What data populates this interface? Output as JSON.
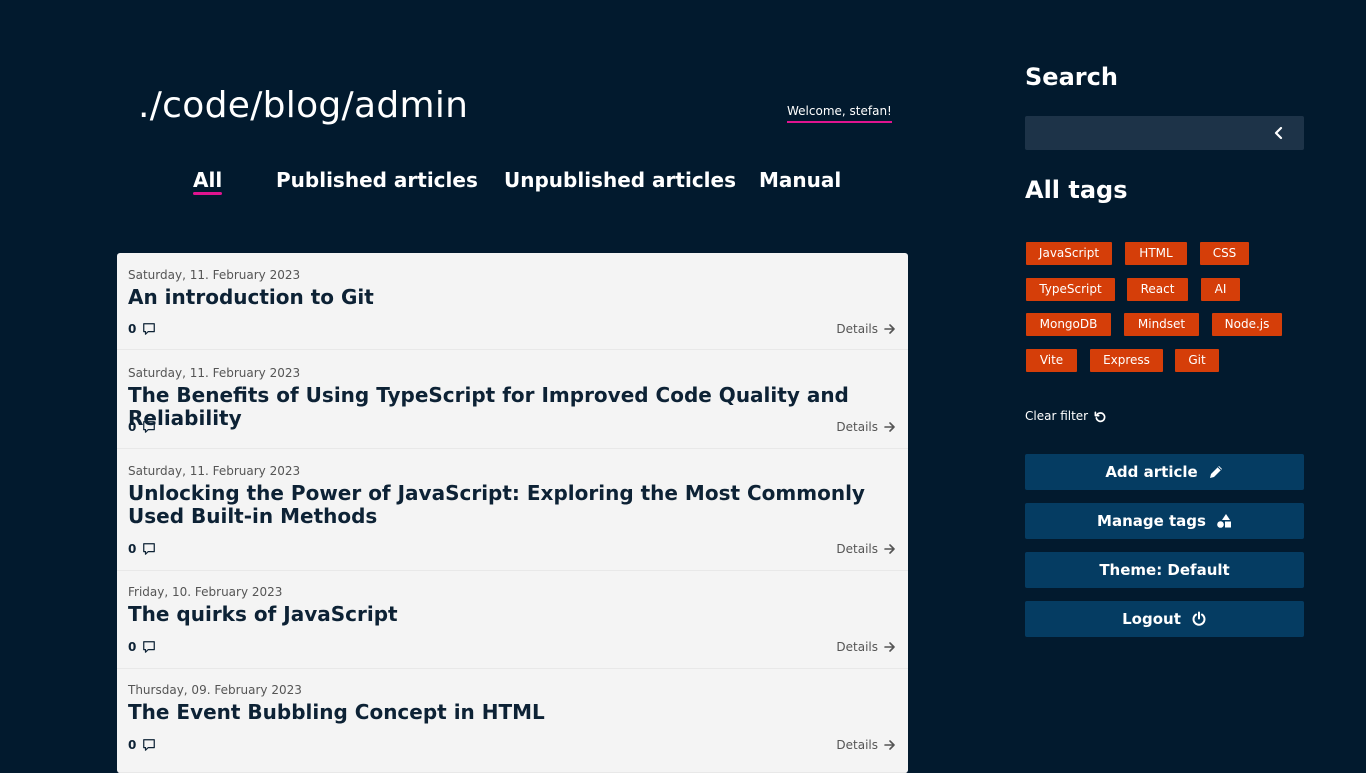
{
  "header": {
    "site_title": "./code/blog/admin",
    "welcome": "Welcome, stefan!"
  },
  "nav": {
    "tabs": [
      {
        "label": "All",
        "active": true
      },
      {
        "label": "Published articles"
      },
      {
        "label": "Unpublished articles"
      },
      {
        "label": "Manual"
      }
    ]
  },
  "articles": [
    {
      "date": "Saturday, 11. February 2023",
      "title": "An introduction to Git",
      "comments": "0",
      "details_label": "Details"
    },
    {
      "date": "Saturday, 11. February 2023",
      "title": "The Benefits of Using TypeScript for Improved Code Quality and Reliability",
      "comments": "0",
      "details_label": "Details"
    },
    {
      "date": "Saturday, 11. February 2023",
      "title": "Unlocking the Power of JavaScript: Exploring the Most Commonly Used Built-in Methods",
      "comments": "0",
      "details_label": "Details"
    },
    {
      "date": "Friday, 10. February 2023",
      "title": "The quirks of JavaScript",
      "comments": "0",
      "details_label": "Details"
    },
    {
      "date": "Thursday, 09. February 2023",
      "title": "The Event Bubbling Concept in HTML",
      "comments": "0",
      "details_label": "Details"
    }
  ],
  "sidebar": {
    "search_heading": "Search",
    "search_value": "",
    "tags_heading": "All tags",
    "tags": [
      "JavaScript",
      "HTML",
      "CSS",
      "TypeScript",
      "React",
      "AI",
      "MongoDB",
      "Mindset",
      "Node.js",
      "Vite",
      "Express",
      "Git"
    ],
    "clear_filter": "Clear filter",
    "buttons": {
      "add_article": "Add article",
      "manage_tags": "Manage tags",
      "theme": "Theme: Default",
      "logout": "Logout"
    }
  },
  "colors": {
    "background": "#021a2e",
    "accent_underline": "#e0148f",
    "tag": "#d53e09",
    "button": "#053c62",
    "search_box": "#1d3348",
    "card": "#f4f4f4"
  },
  "icons": {
    "comment": "comment-icon",
    "details": "arrow-right-icon",
    "search": "chevron-left-icon",
    "clear_filter": "undo-icon",
    "add_article": "pencil-icon",
    "manage_tags": "shapes-icon",
    "logout": "power-icon"
  }
}
